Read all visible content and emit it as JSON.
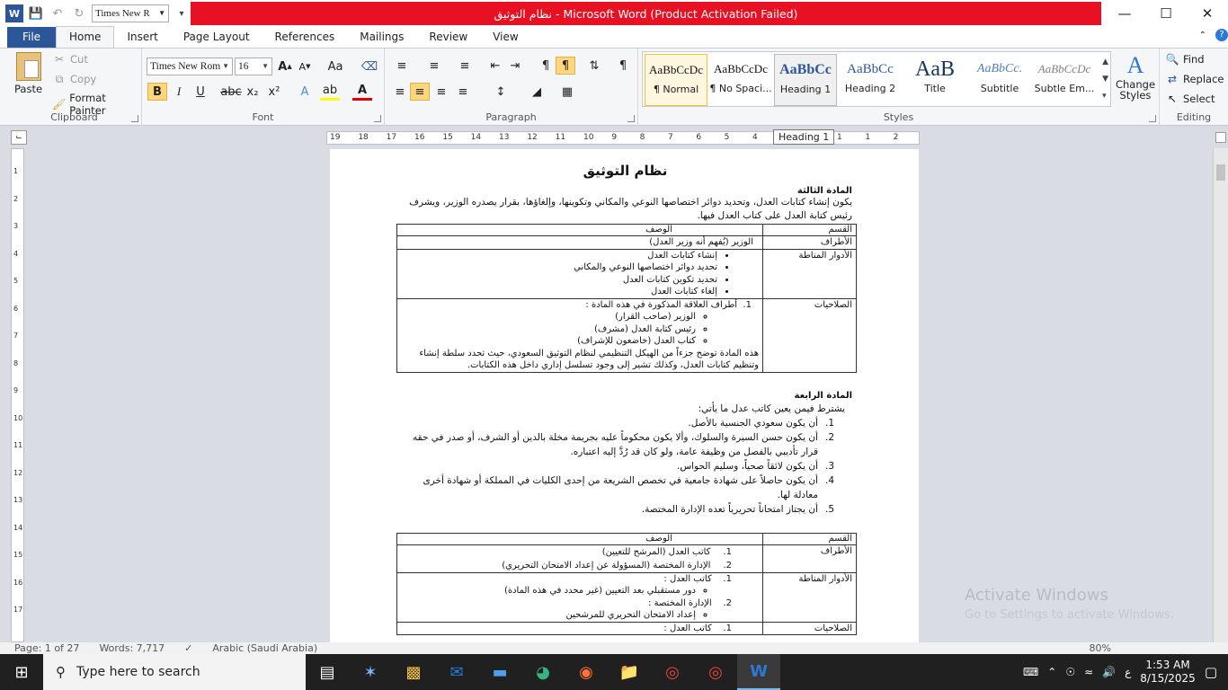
{
  "titlebar": {
    "qat_font": "Times New R",
    "title": "نظام التوثيق  -  Microsoft Word (Product Activation Failed)",
    "icons": [
      "word-icon",
      "save-icon",
      "undo-icon",
      "redo-icon"
    ]
  },
  "tabs": [
    "File",
    "Home",
    "Insert",
    "Page Layout",
    "References",
    "Mailings",
    "Review",
    "View"
  ],
  "ribbon": {
    "clipboard": {
      "paste": "Paste",
      "cut": "Cut",
      "copy": "Copy",
      "format_painter": "Format Painter",
      "label": "Clipboard"
    },
    "font": {
      "name": "Times New Rom",
      "size": "16",
      "label": "Font"
    },
    "paragraph": {
      "label": "Paragraph"
    },
    "styles": {
      "label": "Styles",
      "items": [
        {
          "preview": "AaBbCcDc",
          "name": "¶ Normal"
        },
        {
          "preview": "AaBbCcDc",
          "name": "¶ No Spaci..."
        },
        {
          "preview": "AaBbCc",
          "name": "Heading 1"
        },
        {
          "preview": "AaBbCc",
          "name": "Heading 2"
        },
        {
          "preview": "AaB",
          "name": "Title"
        },
        {
          "preview": "AaBbCc.",
          "name": "Subtitle"
        },
        {
          "preview": "AaBbCcDc",
          "name": "Subtle Em..."
        }
      ],
      "change_styles": "Change Styles"
    },
    "editing": {
      "find": "Find",
      "replace": "Replace",
      "select": "Select",
      "label": "Editing"
    }
  },
  "ruler": {
    "numbers": [
      "19",
      "18",
      "17",
      "16",
      "15",
      "14",
      "13",
      "12",
      "11",
      "10",
      "9",
      "8",
      "7",
      "6",
      "5",
      "4",
      "3",
      "2",
      "1",
      "1",
      "2"
    ],
    "tooltip": "Heading 1"
  },
  "vruler": [
    "1",
    "2",
    "3",
    "4",
    "5",
    "6",
    "7",
    "8",
    "9",
    "10",
    "11",
    "12",
    "13",
    "14",
    "15",
    "16",
    "17"
  ],
  "document": {
    "title": "نظام التوثيق",
    "art3_heading": "المادة الثالثة",
    "art3_text": "يكون إنشاء كتابات العدل، وتحديد دوائر اختصاصها النوعي والمكاني وتكوينها، وإلغاؤها، بقرار يصدره الوزير، ويشرف رئيس كتابة العدل على كتاب العدل فيها.",
    "table1": {
      "head": [
        "القسم",
        "الوصف"
      ],
      "parties_label": "الأطراف",
      "parties_value": "الوزير (يُفهم أنه وزير العدل)",
      "roles_label": "الأدوار المناطة",
      "roles": [
        "إنشاء كتابات العدل",
        "تحديد دوائر اختصاصها النوعي والمكاني",
        "تحديد تكوين كتابات العدل",
        "إلغاء كتابات العدل"
      ],
      "powers_label": "الصلاحيات",
      "powers_intro": "أطراف العلاقة المذكورة في هذه المادة :",
      "powers_sub": [
        "الوزير (صاحب القرار)",
        "رئيس كتابة العدل (مشرف)",
        "كتاب العدل (خاضعون للإشراف)"
      ],
      "powers_note": "هذه المادة توضح جزءاً من الهيكل التنظيمي لنظام التوثيق السعودي، حيث تحدد سلطة إنشاء وتنظيم كتابات العدل، وكذلك تشير إلى وجود تسلسل إداري داخل هذه الكتابات."
    },
    "art4_heading": "المادة الرابعة",
    "art4_intro": "يشترط فيمن يعين كاتب عدل ما يأتي:",
    "art4_items": [
      {
        "n": "1.",
        "text": "أن يكون سعودي الجنسية بالأصل."
      },
      {
        "n": "2.",
        "text": "أن يكون حسن السيرة والسلوك، وألا يكون محكوماً عليه بجريمة مخلة بالدين أو الشرف، أو صدر في حقه قرار تأديبي بالفصل من وظيفة عامة، ولو كان قد رُدَّ إليه اعتباره."
      },
      {
        "n": "3.",
        "text": "أن يكون لائقاً صحياً، وسليم الحواس."
      },
      {
        "n": "4.",
        "text": "أن يكون حاصلاً على شهادة جامعية في تخصص الشريعة من إحدى الكليات في المملكة أو شهادة أخرى معادلة لها."
      },
      {
        "n": "5.",
        "text": "أن يجتاز امتحاناً تحريرياً تعده الإدارة المختصة."
      }
    ],
    "table2": {
      "head": [
        "القسم",
        "الوصف"
      ],
      "parties_label": "الأطراف",
      "parties": [
        {
          "n": "1.",
          "text": "كاتب العدل (المرشح للتعيين)"
        },
        {
          "n": "2.",
          "text": "الإدارة المختصة (المسؤولة عن إعداد الامتحان التحريري)"
        }
      ],
      "roles_label": "الأدوار المناطة",
      "roles_1": "كاتب العدل :",
      "roles_1_sub": "دور مستقبلي بعد التعيين (غير محدد في هذه المادة)",
      "roles_2": "الإدارة المختصة :",
      "roles_2_sub": "إعداد الامتحان التحريري للمرشحين",
      "powers_label": "الصلاحيات",
      "powers_1": "كاتب العدل :"
    }
  },
  "watermark": {
    "line1": "Activate Windows",
    "line2": "Go to Settings to activate Windows."
  },
  "status": {
    "page": "Page: 1 of 27",
    "words": "Words: 7,717",
    "lang": "Arabic (Saudi Arabia)",
    "zoom": "80%"
  },
  "taskbar": {
    "search_placeholder": "Type here to search",
    "time": "1:53 AM",
    "date": "8/15/2025",
    "lang": "ع"
  }
}
